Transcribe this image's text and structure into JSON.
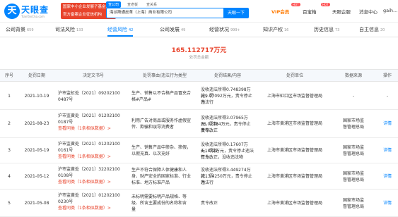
{
  "header": {
    "logo_glyph": "天",
    "logo_text": "天眼查",
    "logo_sub": "TianYanCha.com",
    "banner_line1": "国家中小企业发展子基金旗下",
    "banner_line2": "官方备案企业征信机构",
    "search_tabs": [
      "查公司",
      "查老板",
      "查关系"
    ],
    "search_value": "海派斯通皮革（上海）商业有限公司",
    "search_button": "天眼一下",
    "nav": [
      "VIP会员",
      "百宝箱",
      "天眼企服",
      "消息中心",
      "gaih..."
    ],
    "badges": [
      "HOT",
      "HOT"
    ]
  },
  "tabs": [
    {
      "label": "公司背景",
      "count": "659"
    },
    {
      "label": "司法风险",
      "count": "133"
    },
    {
      "label": "经营风险",
      "count": "42"
    },
    {
      "label": "公司发展",
      "count": "49"
    },
    {
      "label": "经营状况",
      "count": "999+"
    },
    {
      "label": "知识产权",
      "count": "16"
    },
    {
      "label": "历史信息",
      "count": "73"
    },
    {
      "label": "自主信息",
      "count": "20"
    }
  ],
  "total": {
    "amount": "165.112717万元",
    "label": "处罚总金额"
  },
  "table": {
    "headers": [
      "序号",
      "处罚日期",
      "决定文书号",
      "处罚事由/违法行为类型",
      "处罚结果/内容",
      "处罚单位",
      "数据来源",
      "操作"
    ],
    "rows": [
      {
        "num": "1",
        "date": "2021-10-19",
        "doc": [
          "沪市监虹处〔2021〕09202100",
          "0487号"
        ],
        "doc_link": "",
        "reason": [
          "生产、销售以不合格产品冒充合",
          "格#产品#"
        ],
        "result": [
          "没收违法所得0.748398万元，罚",
          "款9.07092万元，责令停止违法行",
          "为"
        ],
        "unit": "上海市虹口区市场监督管理局",
        "source": [
          "-"
        ],
        "op": "-"
      },
      {
        "num": "2",
        "date": "2021-08-23",
        "doc": [
          "沪市监黄处〔2021〕01202100",
          "0187号"
        ],
        "doc_link": "查看同类（1条相似数据）>",
        "reason": [
          "利用广告对商品或服务作虚假宣",
          "传、欺骗和误导消费者"
        ],
        "result": [
          "没收违法所得3.07965万元，罚款",
          "26.02784万元，责令停止发布，",
          "责令改正"
        ],
        "unit": "上海市黄浦区市场监督管理局",
        "source": [
          "国家市场监",
          "督管理总局"
        ],
        "op": "详情"
      },
      {
        "num": "3",
        "date": "2021-05-19",
        "doc": [
          "沪市监黄处〔2021〕01202100",
          "0161号"
        ],
        "doc_link": "查看同类（1条相似数据）>",
        "reason": [
          "生产、销售产品中掺杂、掺假，",
          "以假充真、以次充好"
        ],
        "result": [
          "没收违法所得0.17607万元，罚款",
          "4.1832万元，责令停止违法行为，",
          "责令改正，没收违法物"
        ],
        "unit": "上海市黄浦区市场监督管理局",
        "source": [
          "国家市场监",
          "督管理总局"
        ],
        "op": "详情"
      },
      {
        "num": "4",
        "date": "2021-05-12",
        "doc": [
          "沪市监黄处〔2021〕32202100",
          "0108号"
        ],
        "doc_link": "查看同类（1条相似数据）>",
        "reason": [
          "生产不符合保障人体健康和人",
          "身、财产安全的国家标准、行业",
          "标准、地方标准产品"
        ],
        "result": [
          "没收违法所得3.449274万元，罚",
          "款13.4250万元，责令停止违法行",
          "为"
        ],
        "unit": "上海市黄浦区市场监督管理局",
        "source": [
          "国家市场监",
          "督管理总局"
        ],
        "op": "详情"
      },
      {
        "num": "5",
        "date": "2021-05-08",
        "doc": [
          "沪市监黄处〔2021〕01202100",
          "0230号"
        ],
        "doc_link": "查看同类（1条相似数据）>",
        "reason": [
          "未标明需要标明产品规格、等",
          "级、所含主要成份的名称和含",
          "量"
        ],
        "result": [
          "责令改正"
        ],
        "unit": "上海市黄浦区市场监督管理局",
        "source": [
          "国家市场监",
          "督管理总局"
        ],
        "op": "详情"
      }
    ]
  }
}
